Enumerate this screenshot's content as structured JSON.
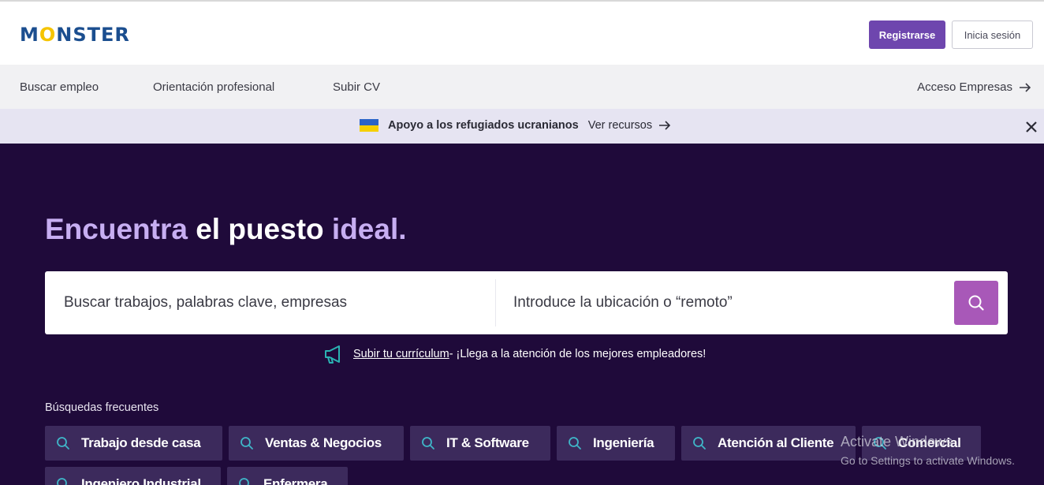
{
  "header": {
    "logo": "MONSTER",
    "register_label": "Registrarse",
    "login_label": "Inicia sesión"
  },
  "nav": {
    "items": [
      {
        "label": "Buscar empleo"
      },
      {
        "label": "Orientación profesional"
      },
      {
        "label": "Subir CV"
      }
    ],
    "employers_label": "Acceso Empresas"
  },
  "banner": {
    "text": "Apoyo a los refugiados ucranianos",
    "link": "Ver recursos"
  },
  "hero": {
    "title_part1": "Encuentra",
    "title_part2": "el puesto",
    "title_part3": "ideal."
  },
  "search": {
    "keyword_placeholder": "Buscar trabajos, palabras clave, empresas",
    "location_placeholder": "Introduce la ubicación o “remoto”"
  },
  "cv_promo": {
    "link": "Subir tu currículum",
    "text": " - ¡Llega a la atención de los mejores empleadores!"
  },
  "frequent": {
    "label": "Búsquedas frecuentes",
    "chips": [
      {
        "label": "Trabajo desde casa"
      },
      {
        "label": "Ventas & Negocios"
      },
      {
        "label": "IT & Software"
      },
      {
        "label": "Ingeniería"
      },
      {
        "label": "Atención al Cliente"
      },
      {
        "label": "Comercial"
      },
      {
        "label": "Ingeniero Industrial"
      },
      {
        "label": "Enfermera"
      }
    ]
  },
  "watermark": {
    "line1": "Activate Windows",
    "line2": "Go to Settings to activate Windows."
  },
  "colors": {
    "hero_bg": "#1f0a3a",
    "accent_purple": "#6e46ae",
    "search_button": "#a858b8",
    "chip_bg": "#3c2a5c",
    "title_light": "#c7aef2"
  }
}
